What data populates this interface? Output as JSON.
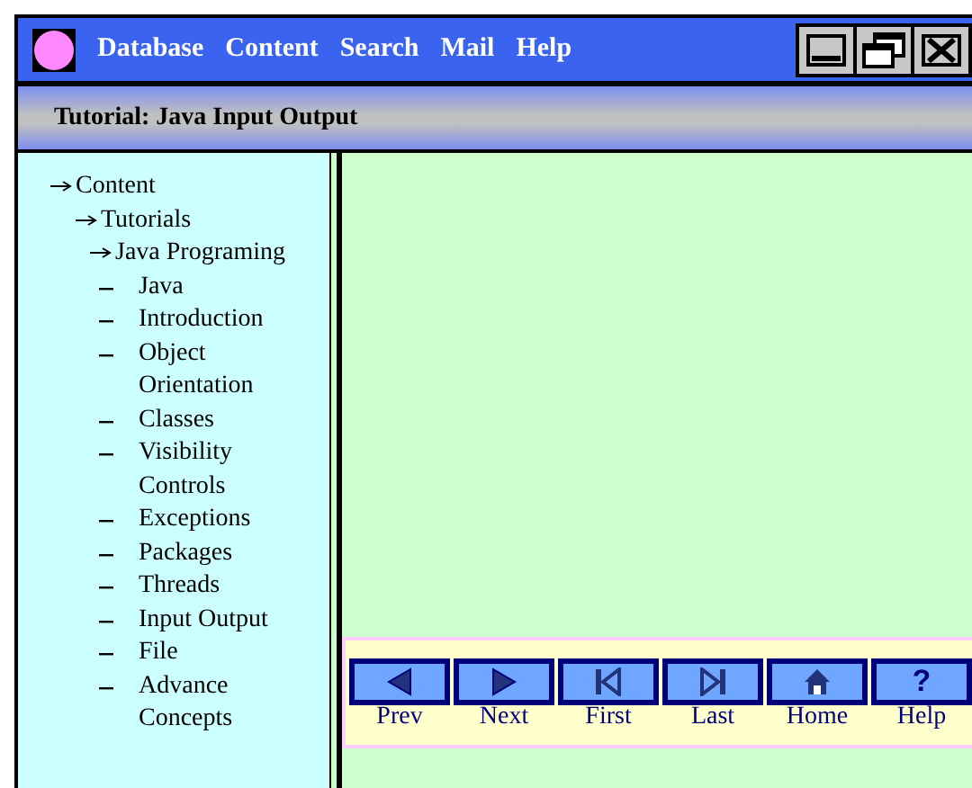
{
  "menu": [
    "Database",
    "Content",
    "Search",
    "Mail",
    "Help"
  ],
  "window_controls": [
    {
      "kind": "minimize"
    },
    {
      "kind": "restore"
    },
    {
      "kind": "close"
    }
  ],
  "title": "Tutorial: Java Input Output",
  "tree": [
    {
      "label": "Content",
      "children": [
        {
          "label": "Tutorials",
          "children": [
            {
              "label": "Java Programing",
              "children": [
                {
                  "label": "Java"
                },
                {
                  "label": "Introduction"
                },
                {
                  "label": "Object Orientation"
                },
                {
                  "label": "Classes"
                },
                {
                  "label": "Visibility Controls"
                },
                {
                  "label": "Exceptions"
                },
                {
                  "label": "Packages"
                },
                {
                  "label": "Threads"
                },
                {
                  "label": "Input Output"
                },
                {
                  "label": "File"
                },
                {
                  "label": "Advance Concepts"
                }
              ]
            }
          ]
        }
      ]
    }
  ],
  "nav": [
    {
      "kind": "prev",
      "label": "Prev"
    },
    {
      "kind": "next",
      "label": "Next"
    },
    {
      "kind": "first",
      "label": "First"
    },
    {
      "kind": "last",
      "label": "Last"
    },
    {
      "kind": "home",
      "label": "Home"
    },
    {
      "kind": "help",
      "glyph": "?",
      "label": "Help"
    }
  ]
}
